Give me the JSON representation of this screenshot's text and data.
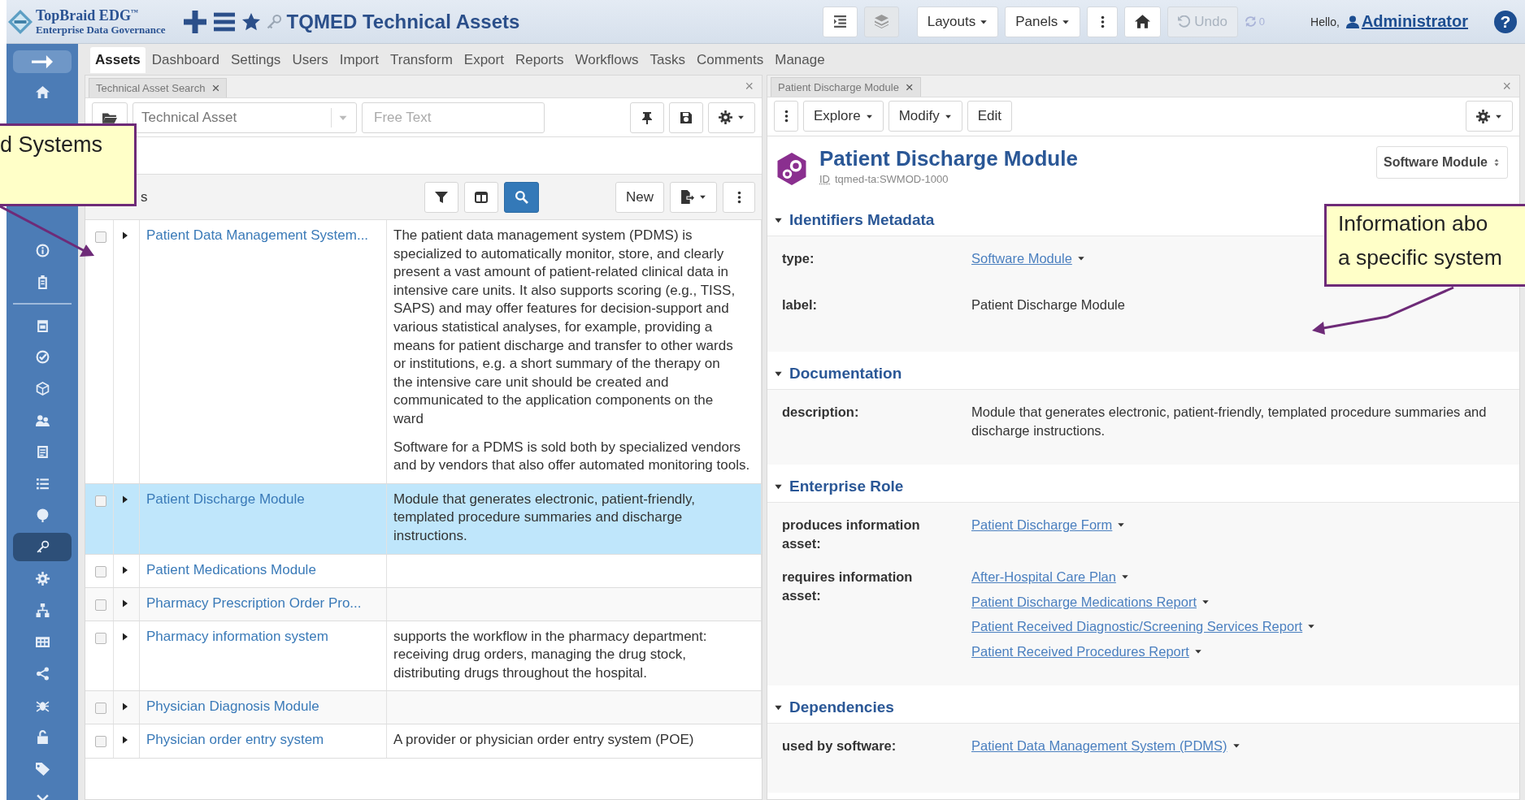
{
  "header": {
    "logo_title": "TopBraid EDG$^{™}$",
    "logo_subtitle": "Enterprise Data Governance",
    "title": "TQMED Technical Assets",
    "layouts_button": "Layouts",
    "panels_button": "Panels",
    "undo": {
      "label": "Undo",
      "disabled": true
    },
    "sync_count": "0",
    "greeting": "Hello,",
    "user": "Administrator",
    "help": "?"
  },
  "sidebar": {
    "items": [
      {
        "selected": false
      },
      {
        "selected": false
      },
      {
        "selected": false
      },
      {
        "selected": false
      },
      {
        "selected": false
      },
      {
        "selected": false
      },
      {
        "selected": false
      },
      {
        "selected": false
      },
      {
        "selected": false
      },
      {
        "selected": false
      },
      {
        "selected": true
      },
      {
        "selected": false
      },
      {
        "selected": false
      },
      {
        "selected": false
      },
      {
        "selected": false
      },
      {
        "selected": false
      },
      {
        "selected": false
      },
      {
        "selected": false
      },
      {
        "selected": false
      }
    ]
  },
  "menu": [
    {
      "label": "Assets",
      "selected": true
    },
    {
      "label": "Dashboard",
      "selected": false
    },
    {
      "label": "Settings",
      "selected": false
    },
    {
      "label": "Users",
      "selected": false
    },
    {
      "label": "Import",
      "selected": false
    },
    {
      "label": "Transform",
      "selected": false
    },
    {
      "label": "Export",
      "selected": false
    },
    {
      "label": "Reports",
      "selected": false
    },
    {
      "label": "Workflows",
      "selected": false
    },
    {
      "label": "Tasks",
      "selected": false
    },
    {
      "label": "Comments",
      "selected": false
    },
    {
      "label": "Manage",
      "selected": false
    }
  ],
  "search_panel": {
    "tab": "Technical Asset Search",
    "close": "×",
    "type_select": "Technical Asset",
    "free_text": {
      "placeholder": "Free Text"
    },
    "count_fragment": "s",
    "new_button": "New",
    "rows": [
      {
        "name": "Patient Data Management System...",
        "description": [
          "The patient data management system (PDMS) is specialized to automatically monitor, store, and clearly present a vast amount of patient-related clinical data in intensive care units. It also supports scoring (e.g., TISS, SAPS) and may offer features for decision-support and various statistical analyses, for example, providing a means for patient discharge and transfer to other wards or institutions, e.g. a short summary of the therapy on the intensive care unit should be created and communicated to the application components on the ward",
          "Software for a PDMS is sold both by specialized vendors and by vendors that also offer automated monitoring tools."
        ],
        "selected": false,
        "checked": false
      },
      {
        "name": "Patient Discharge Module",
        "description": [
          "Module that generates electronic, patient-friendly, templated procedure summaries and discharge instructions."
        ],
        "selected": true,
        "checked": false
      },
      {
        "name": "Patient Medications Module",
        "description": [],
        "selected": false,
        "checked": false
      },
      {
        "name": "Pharmacy Prescription Order Pro...",
        "description": [],
        "selected": false,
        "checked": false
      },
      {
        "name": "Pharmacy information system",
        "description": [
          "supports the workflow in the pharmacy department: receiving drug orders, managing the drug stock, distributing drugs throughout the hospital."
        ],
        "selected": false,
        "checked": false
      },
      {
        "name": "Physician Diagnosis Module",
        "description": [],
        "selected": false,
        "checked": false
      },
      {
        "name": "Physician order entry system",
        "description": [
          "A provider or physician order entry system (POE)"
        ],
        "selected": false,
        "checked": false
      }
    ]
  },
  "detail_panel": {
    "tab": "Patient Discharge Module",
    "close": "×",
    "explore_button": "Explore",
    "modify_button": "Modify",
    "edit_button": "Edit",
    "title": "Patient Discharge Module",
    "id_label": "ID",
    "id_value": "tqmed-ta:SWMOD-1000",
    "type_select": "Software Module",
    "sections": [
      {
        "title": "Identifiers Metadata",
        "expanded": true,
        "fields": [
          {
            "label": "type:",
            "values": [
              {
                "kind": "link",
                "text": "Software Module"
              }
            ]
          },
          {
            "label": "label:",
            "values": [
              {
                "kind": "text",
                "text": "Patient Discharge Module"
              }
            ]
          }
        ]
      },
      {
        "title": "Documentation",
        "expanded": true,
        "fields": [
          {
            "label": "description:",
            "values": [
              {
                "kind": "text",
                "text": "Module that generates electronic, patient-friendly, templated procedure summaries and discharge instructions."
              }
            ]
          }
        ]
      },
      {
        "title": "Enterprise Role",
        "expanded": true,
        "fields": [
          {
            "label": "produces information asset:",
            "values": [
              {
                "kind": "link",
                "text": "Patient Discharge Form"
              }
            ]
          },
          {
            "label": "requires information asset:",
            "values": [
              {
                "kind": "link",
                "text": "After-Hospital Care Plan"
              },
              {
                "kind": "link",
                "text": "Patient Discharge Medications Report"
              },
              {
                "kind": "link",
                "text": "Patient Received Diagnostic/Screening Services Report"
              },
              {
                "kind": "link",
                "text": "Patient Received Procedures Report"
              }
            ]
          }
        ]
      },
      {
        "title": "Dependencies",
        "expanded": true,
        "fields": [
          {
            "label": "used by software:",
            "values": [
              {
                "kind": "link",
                "text": "Patient Data Management System (PDMS)"
              }
            ]
          }
        ]
      }
    ]
  },
  "callouts": [
    {
      "text": "d Systems"
    },
    {
      "text": "Information abo\na specific system"
    }
  ]
}
